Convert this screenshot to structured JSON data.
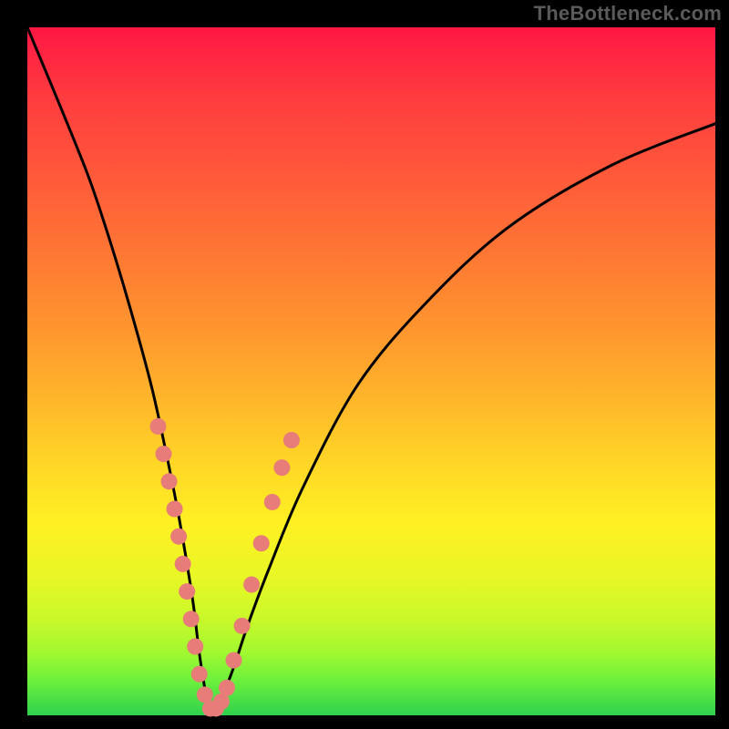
{
  "watermark": {
    "text": "TheBottleneck.com"
  },
  "chart_data": {
    "type": "line",
    "title": "",
    "xlabel": "",
    "ylabel": "",
    "xlim": [
      0,
      100
    ],
    "ylim": [
      0,
      100
    ],
    "series": [
      {
        "name": "bottleneck-curve",
        "x": [
          0,
          5,
          9,
          12,
          15,
          18,
          20,
          22,
          24,
          25,
          26,
          27,
          28,
          30,
          32,
          35,
          40,
          48,
          58,
          70,
          85,
          100
        ],
        "values": [
          100,
          88,
          78,
          69,
          59,
          48,
          39,
          29,
          17,
          9,
          3,
          1,
          2,
          7,
          13,
          21,
          33,
          48,
          60,
          71,
          80,
          86
        ]
      }
    ],
    "markers": {
      "name": "salmon-dots",
      "color": "#e77c78",
      "points": [
        {
          "x": 19.0,
          "y": 42
        },
        {
          "x": 19.8,
          "y": 38
        },
        {
          "x": 20.6,
          "y": 34
        },
        {
          "x": 21.4,
          "y": 30
        },
        {
          "x": 22.0,
          "y": 26
        },
        {
          "x": 22.6,
          "y": 22
        },
        {
          "x": 23.2,
          "y": 18
        },
        {
          "x": 23.8,
          "y": 14
        },
        {
          "x": 24.4,
          "y": 10
        },
        {
          "x": 25.0,
          "y": 6
        },
        {
          "x": 25.8,
          "y": 3
        },
        {
          "x": 26.6,
          "y": 1
        },
        {
          "x": 27.4,
          "y": 1
        },
        {
          "x": 28.2,
          "y": 2
        },
        {
          "x": 29.0,
          "y": 4
        },
        {
          "x": 30.0,
          "y": 8
        },
        {
          "x": 31.2,
          "y": 13
        },
        {
          "x": 32.6,
          "y": 19
        },
        {
          "x": 34.0,
          "y": 25
        },
        {
          "x": 35.6,
          "y": 31
        },
        {
          "x": 37.0,
          "y": 36
        },
        {
          "x": 38.4,
          "y": 40
        }
      ]
    }
  }
}
